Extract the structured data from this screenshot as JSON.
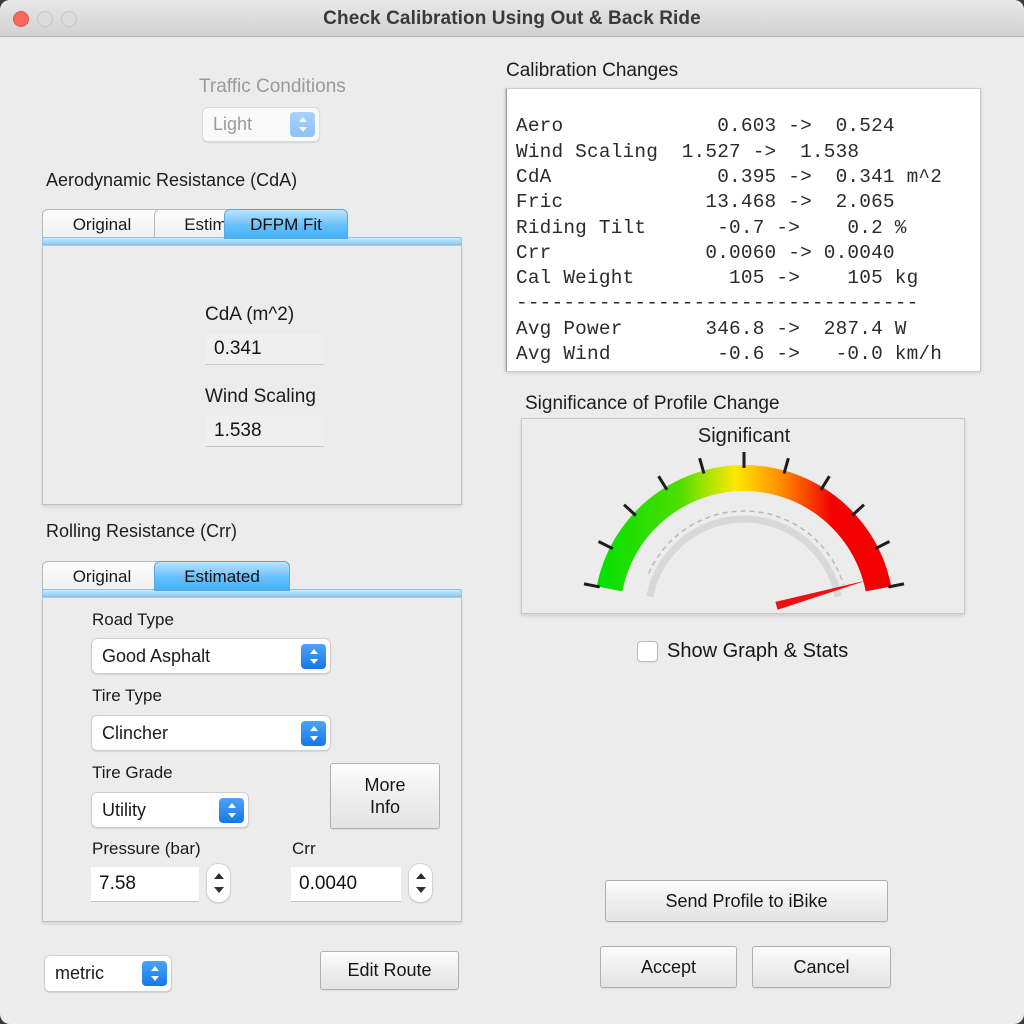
{
  "window": {
    "title": "Check Calibration Using Out & Back Ride",
    "traffic_lights": [
      "close",
      "minimize",
      "maximize"
    ]
  },
  "traffic": {
    "label": "Traffic Conditions",
    "value": "Light",
    "disabled": true
  },
  "aero": {
    "group_label": "Aerodynamic Resistance (CdA)",
    "tabs": [
      {
        "label": "Original",
        "selected": false
      },
      {
        "label": "Estimated",
        "selected": false
      },
      {
        "label": "DFPM Fit",
        "selected": true
      }
    ],
    "cda_label": "CdA (m^2)",
    "cda_value": "0.341",
    "wind_label": "Wind Scaling",
    "wind_value": "1.538"
  },
  "crr": {
    "group_label": "Rolling Resistance (Crr)",
    "tabs": [
      {
        "label": "Original",
        "selected": false
      },
      {
        "label": "Estimated",
        "selected": true
      }
    ],
    "road_type_label": "Road Type",
    "road_type_value": "Good Asphalt",
    "tire_type_label": "Tire Type",
    "tire_type_value": "Clincher",
    "tire_grade_label": "Tire Grade",
    "tire_grade_value": "Utility",
    "more_info_label": "More\nInfo",
    "pressure_label": "Pressure (bar)",
    "pressure_value": "7.58",
    "crr_label": "Crr",
    "crr_value": "0.0040"
  },
  "calibration_changes": {
    "heading": "Calibration Changes",
    "rows": [
      {
        "name": "Aero",
        "from": "0.603",
        "to": "0.524",
        "unit": ""
      },
      {
        "name": "Wind Scaling",
        "from": "1.527",
        "to": "1.538",
        "unit": ""
      },
      {
        "name": "CdA",
        "from": "0.395",
        "to": "0.341",
        "unit": "m^2"
      },
      {
        "name": "Fric",
        "from": "13.468",
        "to": "2.065",
        "unit": ""
      },
      {
        "name": "Riding Tilt",
        "from": "-0.7",
        "to": "0.2",
        "unit": "%"
      },
      {
        "name": "Crr",
        "from": "0.0060",
        "to": "0.0040",
        "unit": ""
      },
      {
        "name": "Cal Weight",
        "from": "105",
        "to": "105",
        "unit": "kg"
      },
      {
        "name": "Avg Power",
        "from": "346.8",
        "to": "287.4",
        "unit": "W"
      },
      {
        "name": "Avg Wind",
        "from": "-0.6",
        "to": "-0.0",
        "unit": "km/h"
      }
    ],
    "text": "Aero             0.603 ->  0.524\nWind Scaling  1.527 ->  1.538\nCdA              0.395 ->  0.341 m^2\nFric            13.468 ->  2.065\nRiding Tilt      -0.7 ->    0.2 %\nCrr             0.0060 -> 0.0040\nCal Weight        105 ->    105 kg\n----------------------------------\nAvg Power       346.8 ->  287.4 W\nAvg Wind         -0.6 ->   -0.0 km/h"
  },
  "significance": {
    "heading": "Significance of Profile Change",
    "caption": "Significant",
    "needle_fraction": 0.97,
    "tick_count": 11,
    "colors": {
      "low": "#00e000",
      "mid": "#ffe800",
      "high": "#f40000",
      "needle": "#f01010"
    }
  },
  "show_graph": {
    "label": "Show Graph & Stats",
    "checked": false
  },
  "footer": {
    "units_value": "metric",
    "edit_route_label": "Edit Route",
    "send_profile_label": "Send Profile to iBike",
    "accept_label": "Accept",
    "cancel_label": "Cancel"
  }
}
